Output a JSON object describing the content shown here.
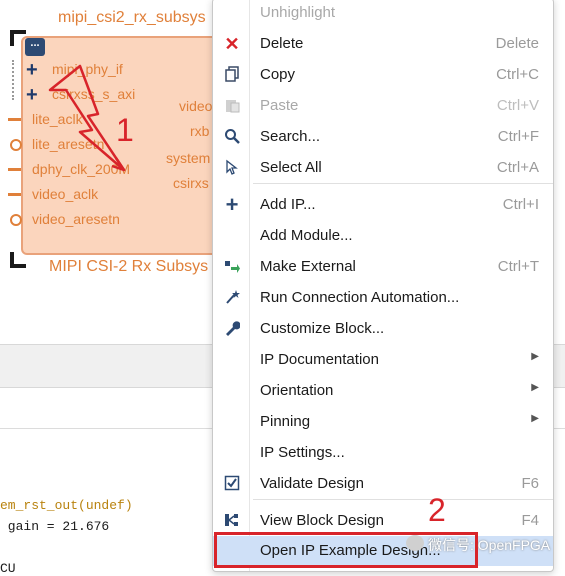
{
  "ip": {
    "instance_name": "mipi_csi2_rx_subsys",
    "block_title": "MIPI CSI-2 Rx Subsys",
    "ports_left": [
      "mipi_phy_if",
      "csirxss_s_axi",
      "lite_aclk",
      "lite_aresetn",
      "dphy_clk_200M",
      "video_aclk",
      "video_aresetn"
    ],
    "ports_right": [
      "video",
      "rxb",
      "system",
      "csirxs"
    ],
    "menu_glyph": "..."
  },
  "annotations": {
    "one": "1",
    "two": "2"
  },
  "log": {
    "line1": "em_rst_out(undef)",
    "line2": " gain = 21.676",
    "line3": "CU"
  },
  "menu": {
    "items": [
      {
        "label": "Unhighlight",
        "shortcut": "",
        "icon": "",
        "disabled": true
      },
      {
        "label": "Delete",
        "shortcut": "Delete",
        "icon": "delete-x-icon",
        "disabled": false
      },
      {
        "label": "Copy",
        "shortcut": "Ctrl+C",
        "icon": "copy-icon",
        "disabled": false
      },
      {
        "label": "Paste",
        "shortcut": "Ctrl+V",
        "icon": "paste-icon",
        "disabled": true
      },
      {
        "label": "Search...",
        "shortcut": "Ctrl+F",
        "icon": "search-icon",
        "disabled": false
      },
      {
        "label": "Select All",
        "shortcut": "Ctrl+A",
        "icon": "select-all-icon",
        "disabled": false
      },
      {
        "label": "Add IP...",
        "shortcut": "Ctrl+I",
        "icon": "add-icon",
        "disabled": false
      },
      {
        "label": "Add Module...",
        "shortcut": "",
        "icon": "",
        "disabled": false
      },
      {
        "label": "Make External",
        "shortcut": "Ctrl+T",
        "icon": "make-external-icon",
        "disabled": false
      },
      {
        "label": "Run Connection Automation...",
        "shortcut": "",
        "icon": "wand-icon",
        "disabled": false
      },
      {
        "label": "Customize Block...",
        "shortcut": "",
        "icon": "wrench-icon",
        "disabled": false
      },
      {
        "label": "IP Documentation",
        "shortcut": "",
        "icon": "",
        "disabled": false,
        "submenu": true
      },
      {
        "label": "Orientation",
        "shortcut": "",
        "icon": "",
        "disabled": false,
        "submenu": true
      },
      {
        "label": "Pinning",
        "shortcut": "",
        "icon": "",
        "disabled": false,
        "submenu": true
      },
      {
        "label": "IP Settings...",
        "shortcut": "",
        "icon": "",
        "disabled": false
      },
      {
        "label": "Validate Design",
        "shortcut": "F6",
        "icon": "validate-icon",
        "disabled": false
      },
      {
        "label": "View Block Design",
        "shortcut": "F4",
        "icon": "view-block-design-icon",
        "disabled": false
      },
      {
        "label": "Open IP Example Design...",
        "shortcut": "",
        "icon": "",
        "disabled": false,
        "highlighted": true
      }
    ]
  },
  "watermark": "微信号: OpenFPGA",
  "colors": {
    "accent_red": "#d8242a",
    "ip_fill": "#fbd5bd",
    "ip_text": "#e0803a",
    "menu_highlight": "#cfe0f7"
  }
}
